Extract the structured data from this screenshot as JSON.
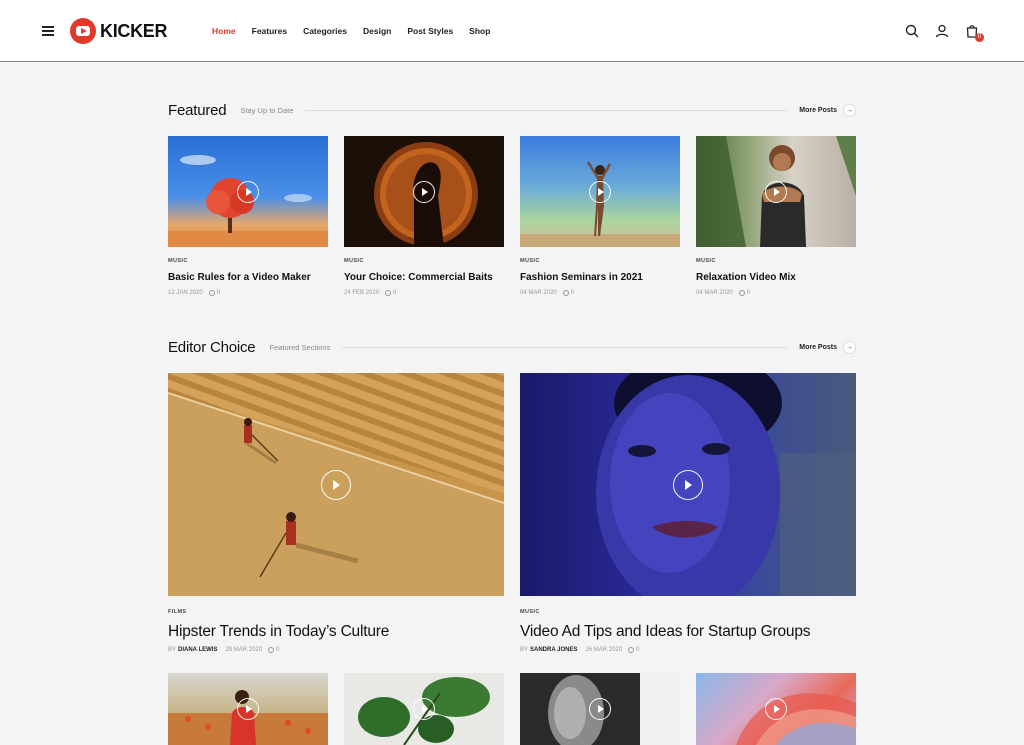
{
  "header": {
    "brand": "KICKER",
    "nav": [
      "Home",
      "Features",
      "Categories",
      "Design",
      "Post Styles",
      "Shop"
    ],
    "cart_count": "0"
  },
  "featured": {
    "title": "Featured",
    "subtitle": "Stay Up to Date",
    "more": "More Posts",
    "posts": [
      {
        "category": "MUSIC",
        "title": "Basic Rules for a Video Maker",
        "date": "12 JAN 2020",
        "comments": "0"
      },
      {
        "category": "MUSIC",
        "title": "Your Choice: Commercial Baits",
        "date": "24 FEB 2020",
        "comments": "0"
      },
      {
        "category": "MUSIC",
        "title": "Fashion Seminars in 2021",
        "date": "04 MAR 2020",
        "comments": "0"
      },
      {
        "category": "MUSIC",
        "title": "Relaxation Video Mix",
        "date": "04 MAR 2020",
        "comments": "0"
      }
    ]
  },
  "editor": {
    "title": "Editor Choice",
    "subtitle": "Featured Sections",
    "more": "More Posts",
    "by": "BY",
    "posts": [
      {
        "category": "FILMS",
        "title": "Hipster Trends in Today’s Culture",
        "author": "DIANA LEWIS",
        "date": "28 MAR 2020",
        "comments": "0"
      },
      {
        "category": "MUSIC",
        "title": "Video Ad Tips and Ideas for Startup Groups",
        "author": "SANDRA JONES",
        "date": "26 MAR 2020",
        "comments": "0"
      }
    ]
  },
  "colors": {
    "accent": "#e03b2a"
  }
}
